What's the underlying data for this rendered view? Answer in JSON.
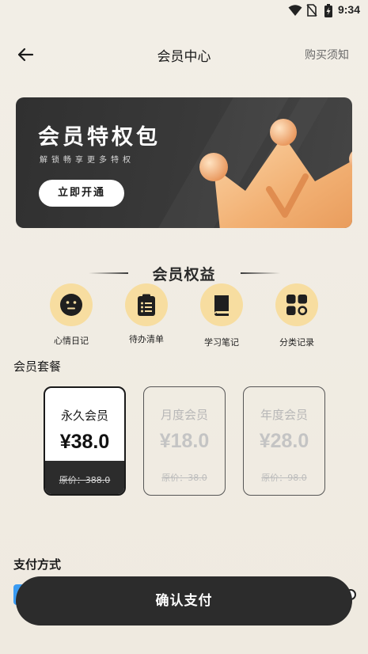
{
  "status_bar": {
    "time": "9:34"
  },
  "header": {
    "title": "会员中心",
    "notice": "购买须知"
  },
  "banner": {
    "title": "会员特权包",
    "subtitle": "解锁畅享更多特权",
    "button": "立即开通"
  },
  "benefits": {
    "title": "会员权益",
    "items": [
      {
        "label": "心情日记",
        "icon": "face-icon"
      },
      {
        "label": "待办清单",
        "icon": "clipboard-icon"
      },
      {
        "label": "学习笔记",
        "icon": "book-icon"
      },
      {
        "label": "分类记录",
        "icon": "grid-icon"
      }
    ]
  },
  "packages": {
    "title": "会员套餐",
    "items": [
      {
        "name": "永久会员",
        "price": "¥38.0",
        "original": "原价：388.0",
        "selected": true
      },
      {
        "name": "月度会员",
        "price": "¥18.0",
        "original": "原价：38.0",
        "selected": false
      },
      {
        "name": "年度会员",
        "price": "¥28.0",
        "original": "原价：98.0",
        "selected": false
      }
    ]
  },
  "payment": {
    "title": "支付方式",
    "confirm": "确认支付"
  },
  "colors": {
    "accent": "#f7dda0",
    "dark": "#2c2c2c",
    "background": "#f2eee6",
    "pay_blue": "#3a9bf2"
  }
}
